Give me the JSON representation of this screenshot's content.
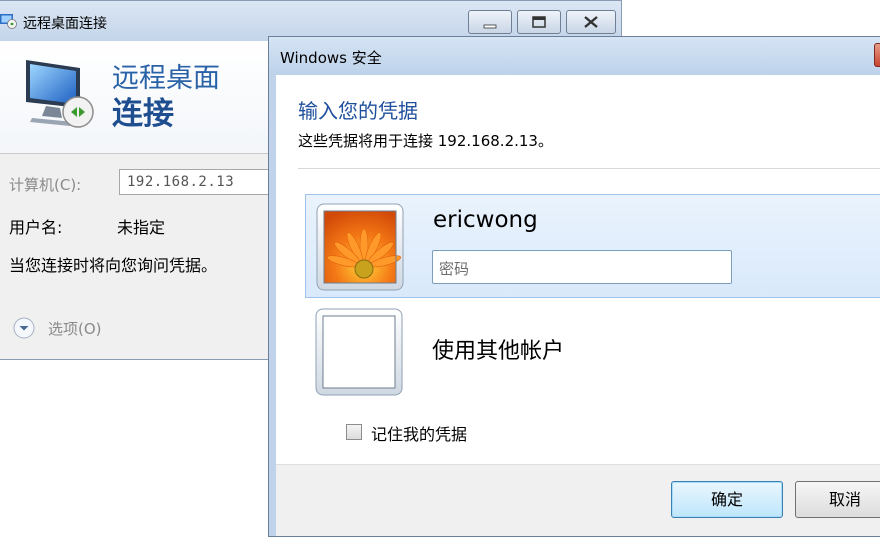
{
  "rdc": {
    "title": "远程桌面连接",
    "heading_line1": "远程桌面",
    "heading_line2": "连接",
    "computer_label": "计算机(C):",
    "computer_value": "192.168.2.13",
    "user_label": "用户名:",
    "user_value": "未指定",
    "note": "当您连接时将向您询问凭据。",
    "options_label": "选项(O)"
  },
  "security": {
    "title": "Windows 安全",
    "heading": "输入您的凭据",
    "subtitle": "这些凭据将用于连接 192.168.2.13。",
    "user_tile": {
      "username": "ericwong",
      "password_placeholder": "密码"
    },
    "other_account_label": "使用其他帐户",
    "remember_label": "记住我的凭据",
    "remember_checked": false,
    "ok_label": "确定",
    "cancel_label": "取消"
  },
  "colors": {
    "heading_blue": "#1e4f9c",
    "tile_selected_bg": "#dbe9fb",
    "tile_selected_border": "#9ec3ea"
  },
  "icons": [
    "rdc-app-icon",
    "monitor-connection-icon",
    "chevron-down-icon",
    "flower-avatar-icon",
    "blank-avatar-icon"
  ]
}
